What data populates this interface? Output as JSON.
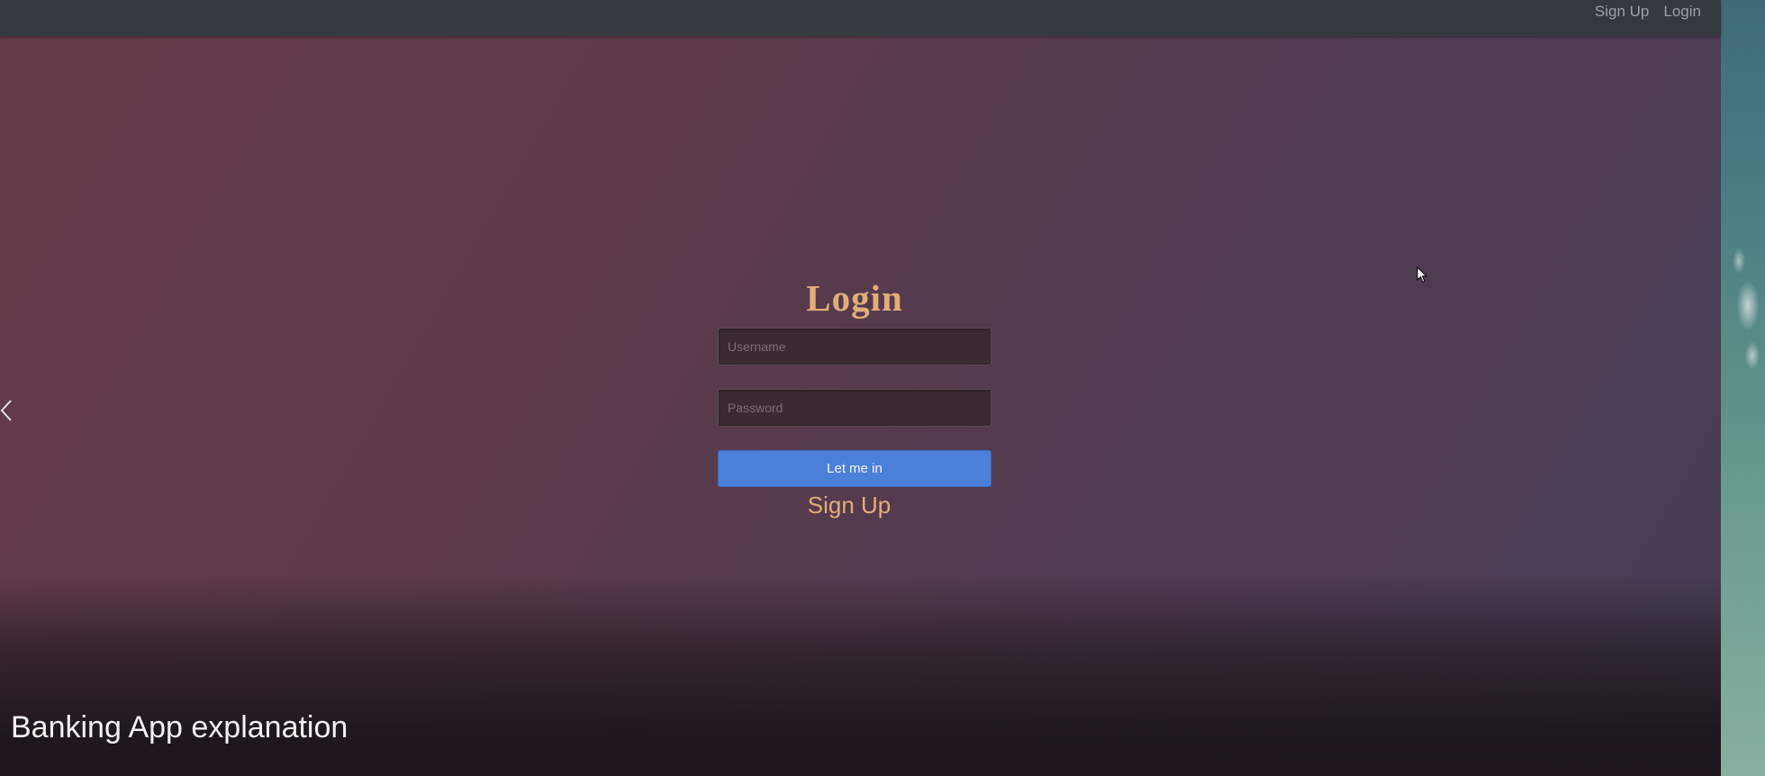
{
  "nav": {
    "signup_label": "Sign Up",
    "login_label": "Login"
  },
  "login_form": {
    "title": "Login",
    "username_placeholder": "Username",
    "password_placeholder": "Password",
    "submit_label": "Let me in",
    "signup_link_label": "Sign Up"
  },
  "slide": {
    "caption": "Banking App explanation",
    "prev_icon": "chevron-left-icon"
  },
  "colors": {
    "topbar": "#34393f",
    "accent_text": "#e2ae78",
    "button": "#4b7fd8",
    "nav_text": "#9aa0a6"
  }
}
